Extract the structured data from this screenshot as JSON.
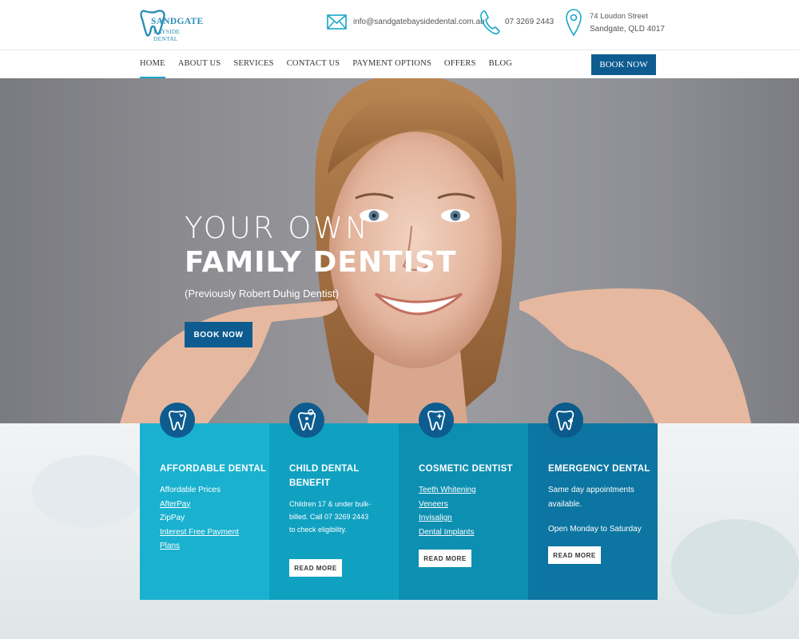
{
  "brand": {
    "name_top": "SANDGATE",
    "name_bottom": "BAYSIDE DENTAL"
  },
  "contact": {
    "email": "info@sandgatebaysidedental.com.au",
    "phone": "07 3269 2443",
    "address_line1": "74 Loudon Street",
    "address_line2": "Sandgate, QLD 4017"
  },
  "nav": {
    "items": [
      "HOME",
      "ABOUT US",
      "SERVICES",
      "CONTACT US",
      "PAYMENT OPTIONS",
      "OFFERS",
      "BLOG"
    ],
    "active": "HOME",
    "book_label": "BOOK NOW"
  },
  "hero": {
    "line1": "YOUR OWN",
    "line2": "FAMILY DENTIST",
    "subtitle": "(Previously Robert Duhig Dentist)",
    "button_label": "BOOK NOW"
  },
  "services": [
    {
      "title": "AFFORDABLE DENTAL",
      "items": [
        {
          "text": "Affordable Prices",
          "link": false
        },
        {
          "text": "AfterPay",
          "link": true
        },
        {
          "text": "ZipPay",
          "link": false
        },
        {
          "text": "Interest Free Payment Plans",
          "link": true
        }
      ]
    },
    {
      "title": "CHILD DENTAL BENEFIT",
      "body": "Children 17 & under bulk-billed. Call 07 3269 2443 to check eligibility.",
      "button_label": "READ MORE"
    },
    {
      "title": "COSMETIC DENTIST",
      "items": [
        {
          "text": "Teeth Whitening",
          "link": true
        },
        {
          "text": "Veneers",
          "link": true
        },
        {
          "text": "Invisalign",
          "link": true
        },
        {
          "text": "Dental Implants",
          "link": true
        }
      ],
      "button_label": "READ MORE"
    },
    {
      "title": "EMERGENCY DENTAL",
      "body": "Same day appointments available.",
      "body2": "Open Monday to Saturday",
      "button_label": "READ MORE"
    }
  ],
  "colors": {
    "primary": "#0e5c8f",
    "accent": "#16a7c7",
    "card1": "#19b1cf",
    "card2": "#10a1c1",
    "card3": "#0d8fb2",
    "card4": "#0c75a1"
  },
  "icons": [
    "tooth-logo-icon",
    "mail-icon",
    "phone-icon",
    "location-pin-icon",
    "tooth-icon",
    "child-tooth-icon",
    "cosmetic-tooth-icon",
    "emergency-tooth-icon"
  ]
}
